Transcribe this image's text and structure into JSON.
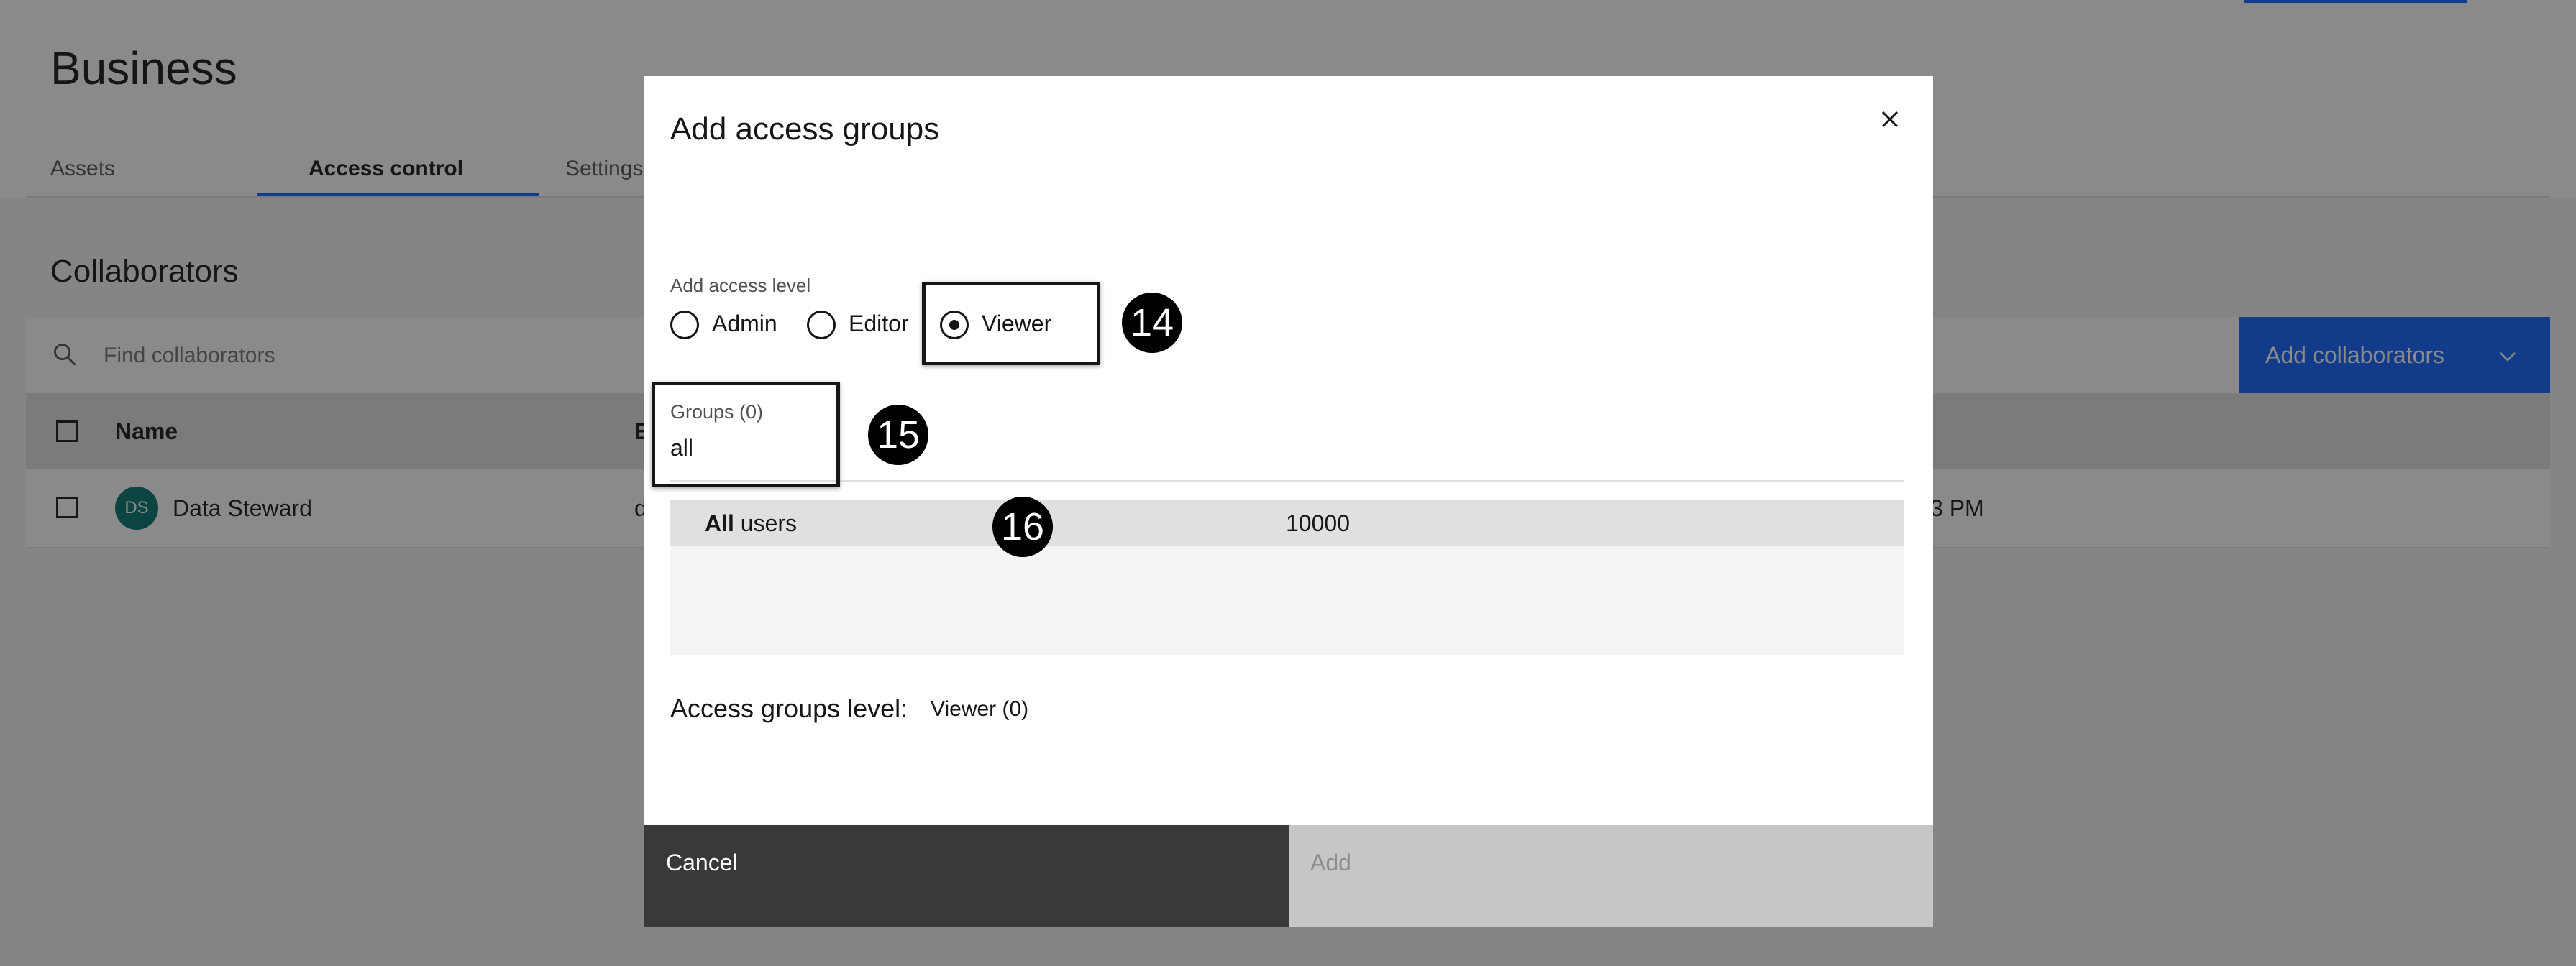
{
  "page": {
    "title": "Business",
    "tabs": [
      {
        "label": "Assets",
        "active": false
      },
      {
        "label": "Access control",
        "active": true
      },
      {
        "label": "Settings",
        "active": false
      }
    ]
  },
  "collaborators": {
    "heading": "Collaborators",
    "search_placeholder": "Find collaborators",
    "add_button_label": "Add collaborators",
    "table": {
      "columns": [
        "Name",
        "E"
      ],
      "rows": [
        {
          "avatar_initials": "DS",
          "name": "Data Steward",
          "email_fragment": "d",
          "time_fragment": "3 PM"
        }
      ]
    }
  },
  "modal": {
    "title": "Add access groups",
    "access_level": {
      "label": "Add access level",
      "options": [
        {
          "label": "Admin",
          "selected": false
        },
        {
          "label": "Editor",
          "selected": false
        },
        {
          "label": "Viewer",
          "selected": true
        }
      ]
    },
    "groups": {
      "label": "Groups (0)",
      "value": "all"
    },
    "results": [
      {
        "name_bold": "All",
        "name_rest": " users",
        "count": "10000"
      }
    ],
    "summary": {
      "label": "Access groups level:",
      "value": "Viewer (0)"
    },
    "cancel_label": "Cancel",
    "add_label": "Add"
  },
  "annotations": [
    "14",
    "15",
    "16"
  ],
  "colors": {
    "accent": "#0f62fe",
    "overlay": "rgba(22,22,22,0.5)",
    "avatar": "#00726b",
    "cancel_button": "#393939",
    "disabled_button": "#c6c6c6"
  }
}
